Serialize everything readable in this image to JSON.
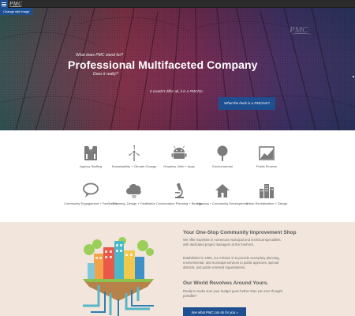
{
  "topbar": {
    "menu_icon": "hamburger-icon",
    "logo_text": "PMC"
  },
  "hero": {
    "change_image_label": "Change site image",
    "logo_text": "PMC",
    "question": "What does PMC stand for?",
    "title": "Professional Multifaceted Company",
    "subtitle": "Does it really?",
    "quote": "It couldn't differ all, it is a PMChm.",
    "cta_label": "What the heck is a PMCism?"
  },
  "services": {
    "items": [
      {
        "label": "Agency Staffing",
        "icon": "suit-person-icon"
      },
      {
        "label": "Sustainability + Climate Change",
        "icon": "wind-turbine-icon"
      },
      {
        "label": "Graphics, Web + Apps",
        "icon": "android-robot-icon"
      },
      {
        "label": "Environmental",
        "icon": "tree-icon"
      },
      {
        "label": "Public Finance",
        "icon": "chart-picture-icon"
      },
      {
        "label": "Community Engagement + Facilitation",
        "icon": "speech-bubble-icon"
      },
      {
        "label": "Planning, Design + Facilitation",
        "icon": "cloud-sketch-icon"
      },
      {
        "label": "Conservation Planning + Biology",
        "icon": "microscope-icon"
      },
      {
        "label": "Housing + Community Development",
        "icon": "house-icon"
      },
      {
        "label": "Urban Revitalization + Design",
        "icon": "buildings-icon"
      }
    ]
  },
  "onestop": {
    "heading": "Your One-Stop Community Improvement Shop",
    "para1": "We offer expertise in numerous municipal and technical specialties, with dedicated project managers at the forefront.",
    "para2": "Established in 1995, our mission is to provide exemplary planning, environmental, and municipal services to public agencies, special districts, and public-oriented organizations.",
    "heading2": "Our World Revolves Around Yours.",
    "para3": "Ready to make sure your budget goes further than you ever thought possible?",
    "cta_label": "See what PMC can do for you »"
  },
  "colors": {
    "brand_blue": "#1d4f91",
    "topbar": "#2b2b2b",
    "section_bg": "#f2e6dc",
    "icon_gray": "#7b7b7b"
  }
}
